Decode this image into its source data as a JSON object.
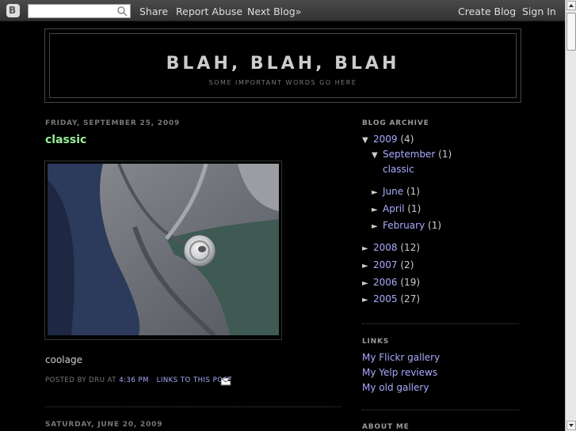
{
  "navbar": {
    "logo_letter": "B",
    "search_placeholder": "",
    "share": "Share",
    "report_abuse": "Report Abuse",
    "next_blog": "Next Blog»",
    "create_blog": "Create Blog",
    "sign_in": "Sign In"
  },
  "header": {
    "title": "BLAH, BLAH, BLAH",
    "description": "SOME IMPORTANT WORDS GO HERE"
  },
  "post": {
    "date": "FRIDAY, SEPTEMBER 25, 2009",
    "title": "classic",
    "body": "coolage",
    "footer_prefix": "POSTED BY DRU AT",
    "time": "4:36 PM",
    "links_to_post": "LINKS TO THIS POST"
  },
  "next_post": {
    "date": "SATURDAY, JUNE 20, 2009"
  },
  "sidebar": {
    "archive_header": "BLOG ARCHIVE",
    "archive": {
      "y2009": {
        "toggle": "▼",
        "label": "2009",
        "count": "(4)"
      },
      "sep": {
        "toggle": "▼",
        "label": "September",
        "count": "(1)"
      },
      "classic": "classic",
      "june": {
        "toggle": "►",
        "label": "June",
        "count": "(1)"
      },
      "april": {
        "toggle": "►",
        "label": "April",
        "count": "(1)"
      },
      "february": {
        "toggle": "►",
        "label": "February",
        "count": "(1)"
      },
      "y2008": {
        "toggle": "►",
        "label": "2008",
        "count": "(12)"
      },
      "y2007": {
        "toggle": "►",
        "label": "2007",
        "count": "(2)"
      },
      "y2006": {
        "toggle": "►",
        "label": "2006",
        "count": "(19)"
      },
      "y2005": {
        "toggle": "►",
        "label": "2005",
        "count": "(27)"
      }
    },
    "links_header": "LINKS",
    "links": [
      "My Flickr gallery",
      "My Yelp reviews",
      "My old gallery"
    ],
    "about_header": "ABOUT ME"
  },
  "colors": {
    "background": "#000000",
    "post_title": "#99ee99",
    "link": "#aaaaff"
  }
}
